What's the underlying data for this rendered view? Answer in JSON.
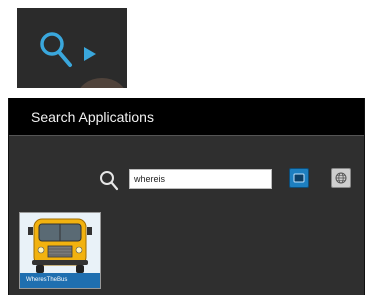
{
  "dialog": {
    "title": "Search Applications",
    "search": {
      "value": "whereis"
    }
  },
  "icons": {
    "top_search": "search-icon",
    "top_play": "play-arrow-icon",
    "device_button": "device-screen-icon",
    "web_button": "globe-icon"
  },
  "results": [
    {
      "name": "WheresTheBus",
      "thumbnail": "school-bus-icon"
    }
  ],
  "colors": {
    "accent_blue": "#1d7fc0",
    "title_bar": "#000000",
    "dialog_bg": "#2f2f2f",
    "label_bar": "#1f6fb0"
  }
}
